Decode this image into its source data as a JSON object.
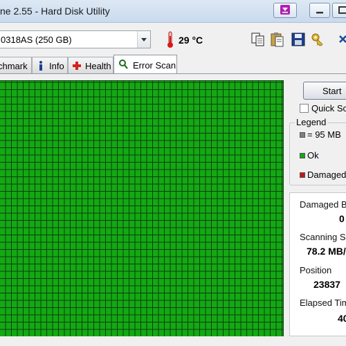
{
  "window": {
    "title": "ne 2.55 - Hard Disk Utility"
  },
  "toolbar": {
    "drive": "0318AS (250 GB)",
    "temperature": "29 °C"
  },
  "tabs": [
    {
      "label": "chmark"
    },
    {
      "label": "Info"
    },
    {
      "label": "Health"
    },
    {
      "label": "Error Scan",
      "active": true
    }
  ],
  "scan": {
    "start_label": "Start",
    "quick_scan_label": "Quick Sca",
    "quick_scan_checked": false
  },
  "legend": {
    "title": "Legend",
    "items": [
      {
        "text": "= 95 MB",
        "color": "#808080"
      },
      {
        "text": "Ok",
        "color": "#14a814"
      },
      {
        "text": "Damaged",
        "color": "#c81414"
      }
    ]
  },
  "stats": {
    "damaged_label": "Damaged Blo",
    "damaged_value": "0",
    "speed_label": "Scanning Spe",
    "speed_value": "78.2 MB/",
    "position_label": "Position",
    "position_value": "23837",
    "elapsed_label": "Elapsed Time",
    "elapsed_value": "40"
  },
  "colors": {
    "ok_block": "#14a814",
    "grid_line": "#0c3f0c",
    "accent_purple": "#b11fb1"
  }
}
